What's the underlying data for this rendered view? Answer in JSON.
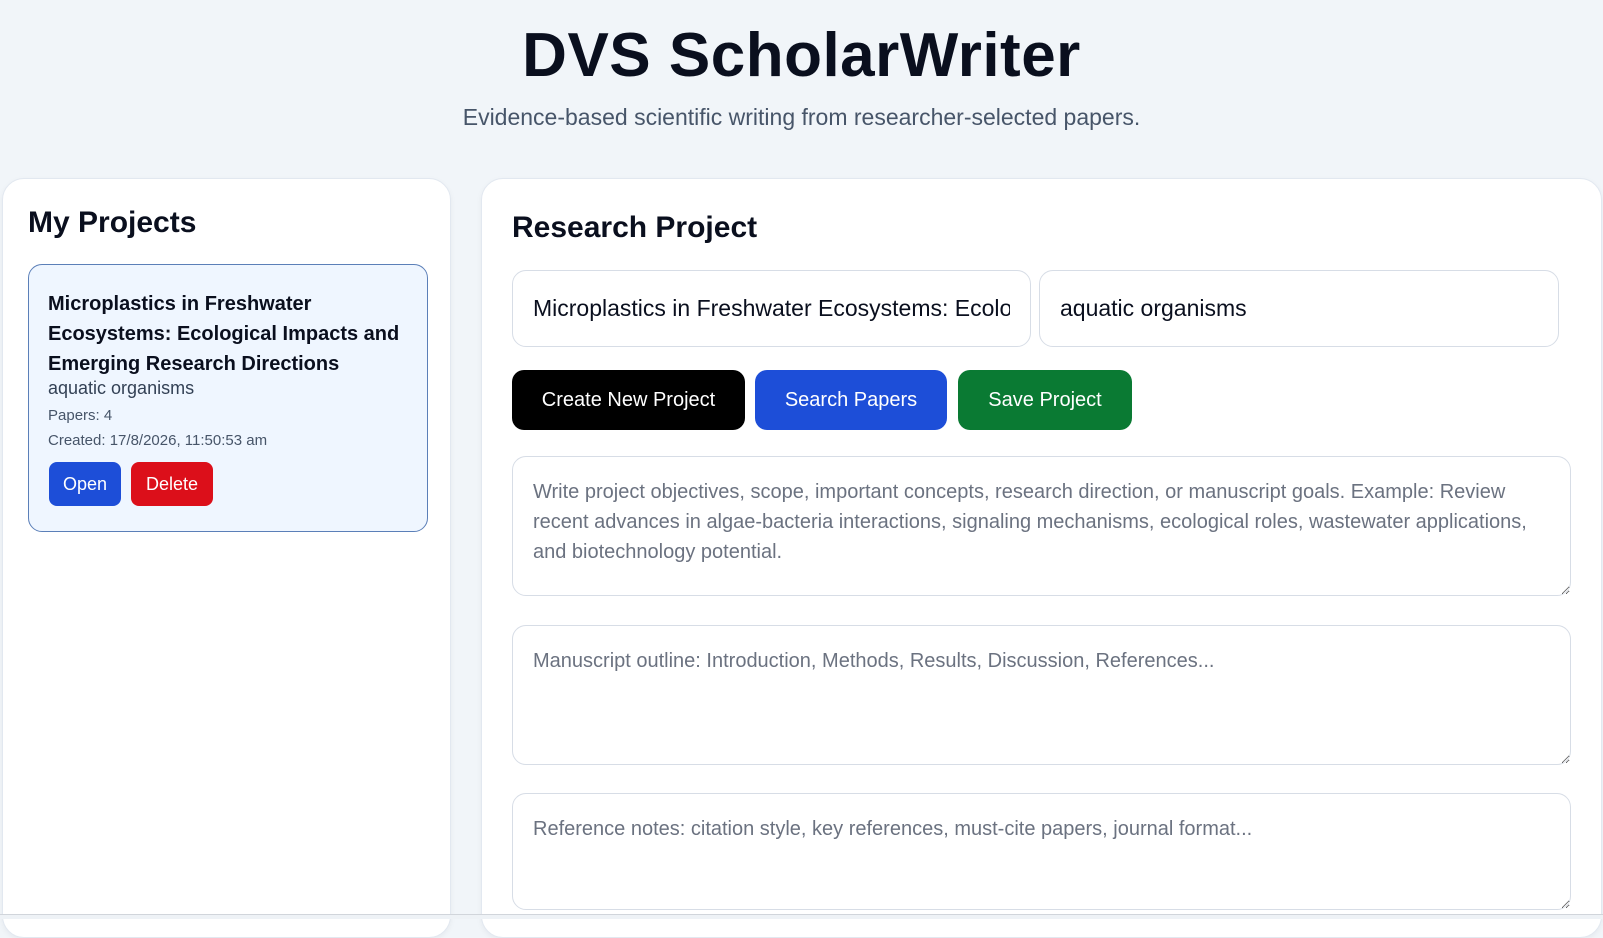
{
  "header": {
    "title": "DVS ScholarWriter",
    "subtitle": "Evidence-based scientific writing from researcher-selected papers."
  },
  "sidebar": {
    "title": "My Projects",
    "projects": [
      {
        "title": "Microplastics in Freshwater Ecosystems: Ecological Impacts and Emerging Research Directions",
        "keyword": "aquatic organisms",
        "papers_label": "Papers:",
        "papers_count": "4",
        "created_label": "Created:",
        "created_value": "17/8/2026, 11:50:53 am",
        "open_label": "Open",
        "delete_label": "Delete"
      }
    ]
  },
  "main": {
    "title": "Research Project",
    "project_title_value": "Microplastics in Freshwater Ecosystems: Ecological Impacts and Emerging Research Directions",
    "keyword_value": "aquatic organisms",
    "buttons": {
      "create": "Create New Project",
      "search": "Search Papers",
      "save": "Save Project"
    },
    "objectives_placeholder": "Write project objectives, scope, important concepts, research direction, or manuscript goals. Example: Review recent advances in algae-bacteria interactions, signaling mechanisms, ecological roles, wastewater applications, and biotechnology potential.",
    "outline_placeholder": "Manuscript outline: Introduction, Methods, Results, Discussion, References...",
    "references_placeholder": "Reference notes: citation style, key references, must-cite papers, journal format..."
  },
  "colors": {
    "primary_blue": "#1d4ed8",
    "danger_red": "#dc0f1a",
    "success_green": "#0a7a33",
    "black": "#000000",
    "card_bg": "#eff6ff",
    "page_bg": "#f1f5f9"
  }
}
